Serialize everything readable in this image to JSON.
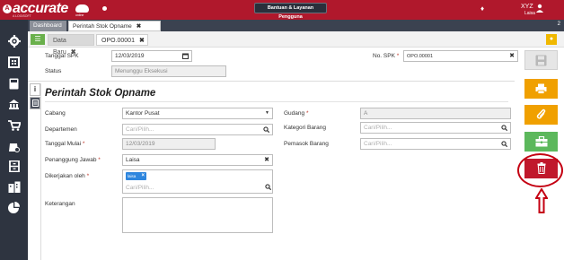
{
  "app": {
    "logo_text": "accurate",
    "logo_subtext": "A LOGISOFT",
    "logo_online": "online",
    "help_button": "Bantuan & Layanan Pengguna",
    "user_name": "XYZ",
    "user_sub": "Laisa"
  },
  "tabs": {
    "dashboard": "Dashboard",
    "active": "Perintah Stok Opname",
    "close_glyph": "✖",
    "count": "2"
  },
  "subtabs": {
    "data_baru": "Data Baru",
    "record": "OPO.00001",
    "close_glyph": "✖"
  },
  "header": {
    "tanggal_spk_label": "Tanggal SPK",
    "tanggal_spk_value": "12/03/2019",
    "status_label": "Status",
    "status_value": "Menunggu Eksekusi",
    "no_spk_label": "No. SPK",
    "no_spk_value": "OPO.00001",
    "required_mark": "*"
  },
  "form": {
    "title": "Perintah Stok Opname",
    "cabang_label": "Cabang",
    "cabang_value": "Kantor Pusat",
    "departemen_label": "Departemen",
    "departemen_placeholder": "Cari/Pilih...",
    "tanggal_mulai_label": "Tanggal Mulai",
    "tanggal_mulai_value": "12/03/2019",
    "penanggung_label": "Penanggung Jawab",
    "penanggung_value": "Laisa",
    "dikerjakan_label": "Dikerjakan oleh",
    "dikerjakan_tag": "laisa",
    "dikerjakan_placeholder": "Cari/Pilih...",
    "keterangan_label": "Keterangan",
    "gudang_label": "Gudang",
    "gudang_value": "A",
    "kategori_label": "Kategori Barang",
    "kategori_placeholder": "Cari/Pilih...",
    "pemasok_label": "Pemasok Barang",
    "pemasok_placeholder": "Cari/Pilih..."
  },
  "icons": {
    "menu": "menu-icon",
    "search": "search-icon",
    "calendar": "calendar-icon",
    "close": "close-icon",
    "dropdown": "chevron-down-icon",
    "save": "save-icon",
    "print": "print-icon",
    "attach": "paperclip-icon",
    "tools": "toolbox-icon",
    "delete": "trash-icon",
    "bell": "bell-icon",
    "user": "user-icon",
    "bulb": "lightbulb-icon",
    "info": "info-icon"
  },
  "colors": {
    "brand": "#b0182c",
    "nav": "#2e3440",
    "print": "#f0a000",
    "tools": "#5cb85c",
    "delete": "#c0182c",
    "annotation": "#c40012"
  }
}
